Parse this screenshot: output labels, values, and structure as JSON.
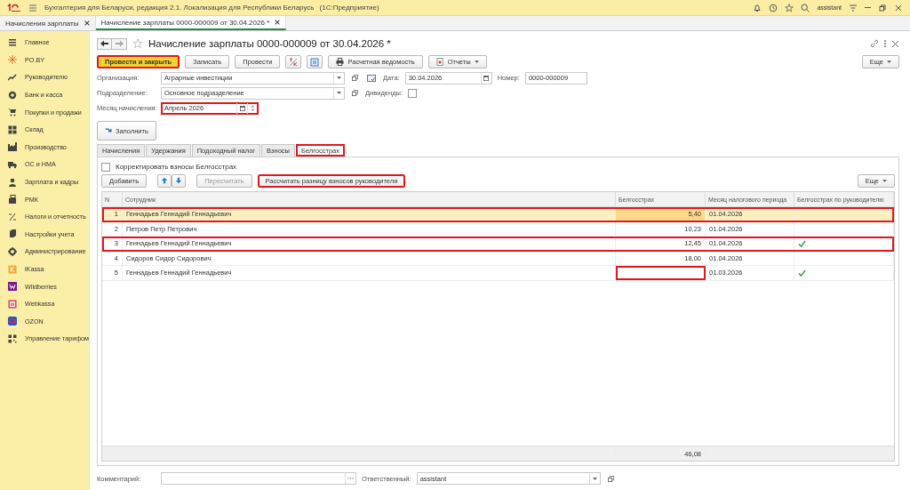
{
  "app_title": "Бухгалтерия для Беларуси, редакция 2.1. Локализация для Республики Беларусь",
  "app_platform": "(1С:Предприятие)",
  "user": "assistant",
  "open_tabs": [
    {
      "label": "Начисления зарплаты",
      "selected": false
    },
    {
      "label": "Начисление зарплаты 0000-000009 от 30.04.2026 *",
      "selected": true
    }
  ],
  "sidebar": {
    "items": [
      {
        "label": "Главное"
      },
      {
        "label": "PO.BY"
      },
      {
        "label": "Руководителю"
      },
      {
        "label": "Банк и касса"
      },
      {
        "label": "Покупки и продажи"
      },
      {
        "label": "Склад"
      },
      {
        "label": "Производство"
      },
      {
        "label": "ОС и НМА"
      },
      {
        "label": "Зарплата и кадры"
      },
      {
        "label": "РМК"
      },
      {
        "label": "Налоги и отчетность"
      },
      {
        "label": "Настройки учета"
      },
      {
        "label": "Администрирование"
      },
      {
        "label": "iKassa"
      },
      {
        "label": "Wildberries"
      },
      {
        "label": "Webkassa"
      },
      {
        "label": "OZON"
      },
      {
        "label": "Управление тарифом"
      }
    ]
  },
  "form": {
    "title": "Начисление зарплаты 0000-000009 от 30.04.2026 *",
    "toolbar": [
      {
        "kind": "default",
        "label": "Провести и закрыть",
        "highlighted": true
      },
      {
        "kind": "text",
        "label": "Записать",
        "highlighted": false
      },
      {
        "kind": "text",
        "label": "Провести",
        "highlighted": false
      },
      {
        "kind": "dtkt",
        "highlighted": false
      },
      {
        "kind": "doc",
        "highlighted": false
      },
      {
        "kind": "print",
        "label": "Расчетная ведомость",
        "highlighted": false
      },
      {
        "kind": "menu",
        "label": "Отчеты",
        "highlighted": false
      }
    ],
    "more": "Еще",
    "organization": {
      "label": "Организация:",
      "value": "Аграрные инвестиции"
    },
    "date": {
      "label": "Дата:",
      "value": "30.04.2026"
    },
    "number": {
      "label": "Номер:",
      "value": "0000-000009"
    },
    "division": {
      "label": "Подразделение:",
      "value": "Основное подразделение"
    },
    "dividends": {
      "label": "Дивиденды:",
      "checked": false
    },
    "month": {
      "label": "Месяц начисления:",
      "value": "Апрель 2026",
      "highlighted": true
    },
    "fill_button": "Заполнить",
    "tabs": [
      {
        "label": "Начисления",
        "selected": false,
        "highlighted": false
      },
      {
        "label": "Удержания",
        "selected": false,
        "highlighted": false
      },
      {
        "label": "Подоходный налог",
        "selected": false,
        "highlighted": false
      },
      {
        "label": "Взносы",
        "selected": false,
        "highlighted": false
      },
      {
        "label": "Белгосстрах",
        "selected": true,
        "highlighted": true
      }
    ],
    "correct_checkbox": {
      "label": "Корректировать взносы Белгосстрах",
      "checked": false
    },
    "table_toolbar": {
      "add": "Добавить",
      "recalc": {
        "label": "Пересчитать",
        "disabled": true
      },
      "calc_diff": {
        "label": "Рассчитать разницу взносов руководителя",
        "highlighted": true
      },
      "more": "Еще"
    },
    "table": {
      "columns": [
        "N",
        "Сотрудник",
        "Белгосстрах",
        "Месяц налогового периода",
        "Белгосстрах по руководителю"
      ],
      "rows": [
        {
          "n": "1",
          "employee": "Геннадьев Геннадий Геннадьевич",
          "amount": "5,40",
          "month": "01.04.2026",
          "by_manager": false,
          "selected": true,
          "highlighted": true,
          "amount_highlighted": false
        },
        {
          "n": "2",
          "employee": "Петров Петр Петрович",
          "amount": "10,23",
          "month": "01.04.2026",
          "by_manager": false,
          "selected": false,
          "highlighted": false,
          "amount_highlighted": false
        },
        {
          "n": "3",
          "employee": "Геннадьев Геннадий Геннадьевич",
          "amount": "12,45",
          "month": "01.04.2026",
          "by_manager": true,
          "selected": false,
          "highlighted": true,
          "amount_highlighted": false
        },
        {
          "n": "4",
          "employee": "Сидоров Сидор Сидорович",
          "amount": "18,00",
          "month": "01.04.2026",
          "by_manager": false,
          "selected": false,
          "highlighted": false,
          "amount_highlighted": false
        },
        {
          "n": "5",
          "employee": "Геннадьев Геннадий Геннадьевич",
          "month": "01.03.2026",
          "by_manager": true,
          "selected": false,
          "highlighted": false,
          "amount_highlighted": true
        }
      ],
      "total": "46,08"
    },
    "comment": {
      "label": "Комментарий:"
    },
    "responsible": {
      "label": "Ответственный:",
      "value": "assistant"
    }
  }
}
